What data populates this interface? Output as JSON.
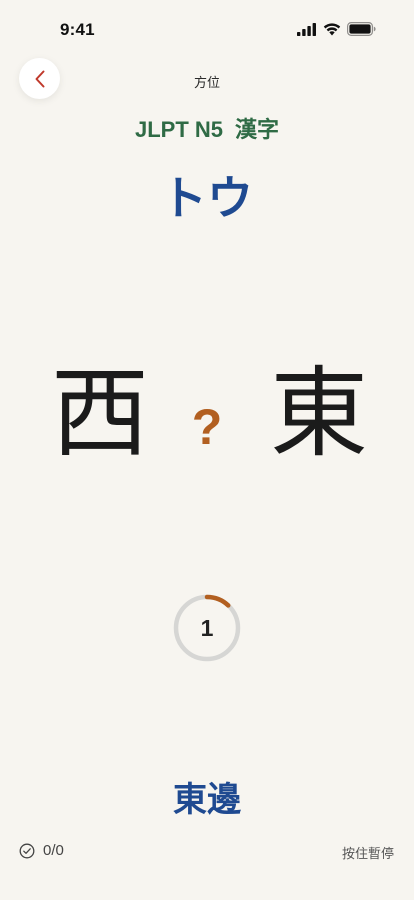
{
  "status_bar": {
    "time": "9:41"
  },
  "header": {
    "topic": "方位",
    "level": "JLPT N5",
    "category": "漢字"
  },
  "quiz": {
    "reading": "トウ",
    "left_kanji": "西",
    "question_mark": "?",
    "right_kanji": "東",
    "timer_value": "1",
    "timer_progress": 0.12,
    "answer_word": "東邊"
  },
  "footer": {
    "score": "0/0",
    "pause_hint": "按住暫停"
  },
  "colors": {
    "background": "#f7f5f0",
    "level_green": "#2f6b45",
    "reading_blue": "#1f4a91",
    "accent_orange": "#b25f20",
    "back_red": "#c0392b"
  },
  "icons": {
    "back": "chevron-left-icon",
    "score": "check-circle-icon",
    "signal": "signal-icon",
    "wifi": "wifi-icon",
    "battery": "battery-icon"
  }
}
